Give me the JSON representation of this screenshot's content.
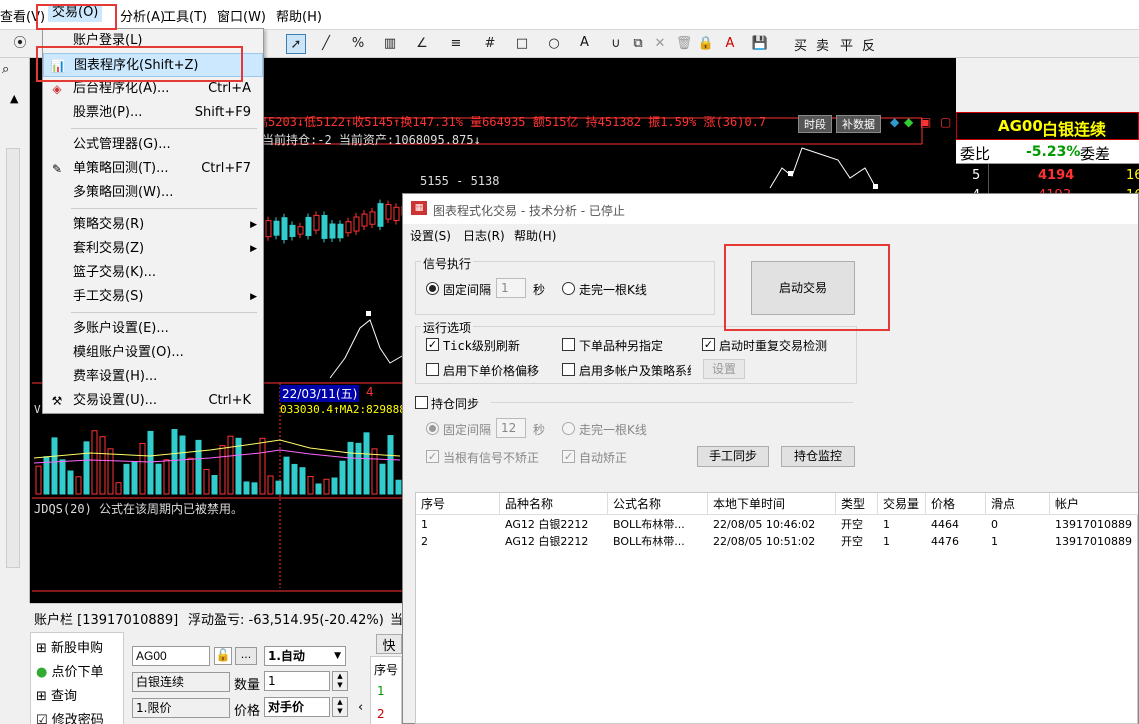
{
  "menubar": {
    "items": [
      "查看(V)",
      "交易(O)",
      "分析(A)",
      "工具(T)",
      "窗口(W)",
      "帮助(H)"
    ]
  },
  "toolbar": {
    "trade_actions": [
      "买",
      "卖",
      "平",
      "反"
    ],
    "font_label": "A"
  },
  "trade_menu": {
    "items": [
      {
        "label": "账户登录(L)",
        "shortcut": ""
      },
      {
        "label": "图表程序化(Shift+Z)",
        "shortcut": ""
      },
      {
        "label": "后台程序化(A)...",
        "shortcut": "Ctrl+A"
      },
      {
        "label": "股票池(P)...",
        "shortcut": "Shift+F9"
      },
      {
        "label": "公式管理器(G)...",
        "shortcut": ""
      },
      {
        "label": "单策略回测(T)...",
        "shortcut": "Ctrl+F7"
      },
      {
        "label": "多策略回测(W)...",
        "shortcut": ""
      },
      {
        "label": "策略交易(R)",
        "shortcut": ""
      },
      {
        "label": "套利交易(Z)",
        "shortcut": ""
      },
      {
        "label": "篮子交易(K)...",
        "shortcut": ""
      },
      {
        "label": "手工交易(S)",
        "shortcut": ""
      },
      {
        "label": "多账户设置(E)...",
        "shortcut": ""
      },
      {
        "label": "模组账户设置(O)...",
        "shortcut": ""
      },
      {
        "label": "费率设置(H)...",
        "shortcut": ""
      },
      {
        "label": "交易设置(U)...",
        "shortcut": "Ctrl+K"
      }
    ]
  },
  "chart": {
    "info_line": "高5203↓低5122↑收5145↑换147.31% 量664935 额515亿 持451382 振1.59% 涨(36)0.7",
    "btn_period": "时段",
    "btn_supplement": "补数据",
    "position_line": "当前持仓:-2 当前资产:1068095.875↓",
    "price_label": "5155 - 5138",
    "date_label": "22/03/11(五)",
    "date_suffix": "4",
    "vol_line_prefix": "V",
    "vol_line": "033030.4↑MA2:829888",
    "indicator_line": "JDQS(20)  公式在该周期内已被禁用。"
  },
  "quote_panel": {
    "code": "AG00",
    "name": "白银连续",
    "weibi_label": "委比",
    "weibi_value": "-5.23%",
    "weicha_label": "委差",
    "row1_level": "5",
    "row1_price": "4194",
    "row1_vol": "16",
    "row2_level": "4",
    "row2_price": "4193",
    "row2_vol": "16"
  },
  "dialog": {
    "title": "图表程式化交易 - 技术分析 - 已停止",
    "menu": [
      "设置(S)",
      "日志(R)",
      "帮助(H)"
    ],
    "signal_group": "信号执行",
    "fixed_interval": "固定间隔",
    "interval_value": "1",
    "unit_sec": "秒",
    "wait_bar": "走完一根K线",
    "start_button": "启动交易",
    "run_group": "运行选项",
    "opt_tick": "Tick级别刷新",
    "opt_other_symbol": "下单品种另指定",
    "opt_restart_check": "启动时重复交易检测",
    "opt_price_offset": "启用下单价格偏移",
    "opt_multi_account": "启用多帐户及策略系统",
    "settings_button": "设置",
    "sync_group": "持仓同步",
    "sync_interval": "固定间隔",
    "sync_interval_value": "12",
    "sync_unit_sec": "秒",
    "sync_wait_bar": "走完一根K线",
    "sync_no_correct": "当根有信号不矫正",
    "sync_auto_correct": "自动矫正",
    "manual_sync_button": "手工同步",
    "position_monitor_button": "持仓监控",
    "table": {
      "columns": [
        "序号",
        "品种名称",
        "公式名称",
        "本地下单时间",
        "类型",
        "交易量",
        "价格",
        "滑点",
        "帐户"
      ],
      "rows": [
        [
          "1",
          "AG12 白银2212",
          "BOLL布林带...",
          "22/08/05 10:46:02",
          "开空",
          "1",
          "4464",
          "0",
          "13917010889"
        ],
        [
          "2",
          "AG12 白银2212",
          "BOLL布林带...",
          "22/08/05 10:51:02",
          "开空",
          "1",
          "4476",
          "1",
          "13917010889"
        ]
      ]
    }
  },
  "account_bar": {
    "title": "账户栏 [13917010889]",
    "float_pnl": "浮动盈亏: -63,514.95(-20.42%)",
    "trailing": "当",
    "left_items": [
      "新股申购",
      "点价下单",
      "查询",
      "修改密码"
    ],
    "symbol_value": "AG00",
    "symbol_name": "白银连续",
    "mode_value": "1.自动",
    "qty_label": "数量",
    "qty_value": "1",
    "order_type": "1.限价",
    "price_label": "价格",
    "price_value": "对手价",
    "quick_tab": "快",
    "seq_header": "序号",
    "seq_rows": [
      "1",
      "2"
    ]
  },
  "colors": {
    "up": "#ff3333",
    "down": "#33cccc",
    "highlight": "#e53935",
    "menu_select": "#cce8ff"
  }
}
